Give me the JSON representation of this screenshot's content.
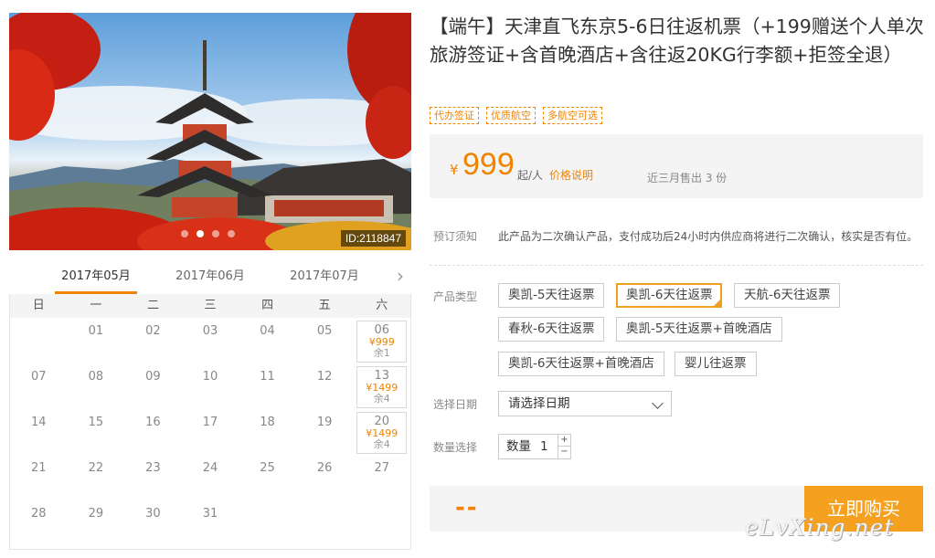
{
  "photo": {
    "id_label": "ID:2118847",
    "slides": 4,
    "active_slide": 1
  },
  "calendar": {
    "months": [
      "2017年05月",
      "2017年06月",
      "2017年07月"
    ],
    "active_month": 0,
    "weekdays": [
      "日",
      "一",
      "二",
      "三",
      "四",
      "五",
      "六"
    ],
    "rows": [
      [
        {
          "d": ""
        },
        {
          "d": "01"
        },
        {
          "d": "02"
        },
        {
          "d": "03"
        },
        {
          "d": "04"
        },
        {
          "d": "05"
        },
        {
          "d": "06",
          "price": "¥999",
          "rem": "余1"
        }
      ],
      [
        {
          "d": "07"
        },
        {
          "d": "08"
        },
        {
          "d": "09"
        },
        {
          "d": "10"
        },
        {
          "d": "11"
        },
        {
          "d": "12"
        },
        {
          "d": "13",
          "price": "¥1499",
          "rem": "余4"
        }
      ],
      [
        {
          "d": "14"
        },
        {
          "d": "15"
        },
        {
          "d": "16"
        },
        {
          "d": "17"
        },
        {
          "d": "18"
        },
        {
          "d": "19"
        },
        {
          "d": "20",
          "price": "¥1499",
          "rem": "余4"
        }
      ],
      [
        {
          "d": "21"
        },
        {
          "d": "22"
        },
        {
          "d": "23"
        },
        {
          "d": "24"
        },
        {
          "d": "25"
        },
        {
          "d": "26"
        },
        {
          "d": "27"
        }
      ],
      [
        {
          "d": "28"
        },
        {
          "d": "29"
        },
        {
          "d": "30"
        },
        {
          "d": "31"
        },
        {
          "d": ""
        },
        {
          "d": ""
        },
        {
          "d": ""
        }
      ]
    ]
  },
  "product": {
    "title": "【端午】天津直飞东京5-6日往返机票（+199赠送个人单次旅游签证+含首晚酒店+含往返20KG行李额+拒签全退）",
    "tags": [
      "代办签证",
      "优质航空",
      "多航空可选"
    ],
    "price": {
      "currency": "¥",
      "amount": "999",
      "from": "起/人",
      "note": "价格说明",
      "sold": "近三月售出 3 份"
    },
    "notice_label": "预订须知",
    "notice_text": "此产品为二次确认产品，支付成功后24小时内供应商将进行二次确认，核实是否有位。",
    "type_label": "产品类型",
    "types": [
      "奥凯-5天往返票",
      "奥凯-6天往返票",
      "天航-6天往返票",
      "春秋-6天往返票",
      "奥凯-5天往返票+首晚酒店",
      "奥凯-6天往返票+首晚酒店",
      "婴儿往返票"
    ],
    "selected_type": 1,
    "date_label": "选择日期",
    "date_placeholder": "请选择日期",
    "qty_label": "数量选择",
    "qty_field_label": "数量",
    "qty_value": "1",
    "total": "--",
    "buy_label": "立即购买"
  },
  "watermark": "eLvXing.net",
  "colors": {
    "accent": "#f08300",
    "button": "#f5a01e"
  }
}
